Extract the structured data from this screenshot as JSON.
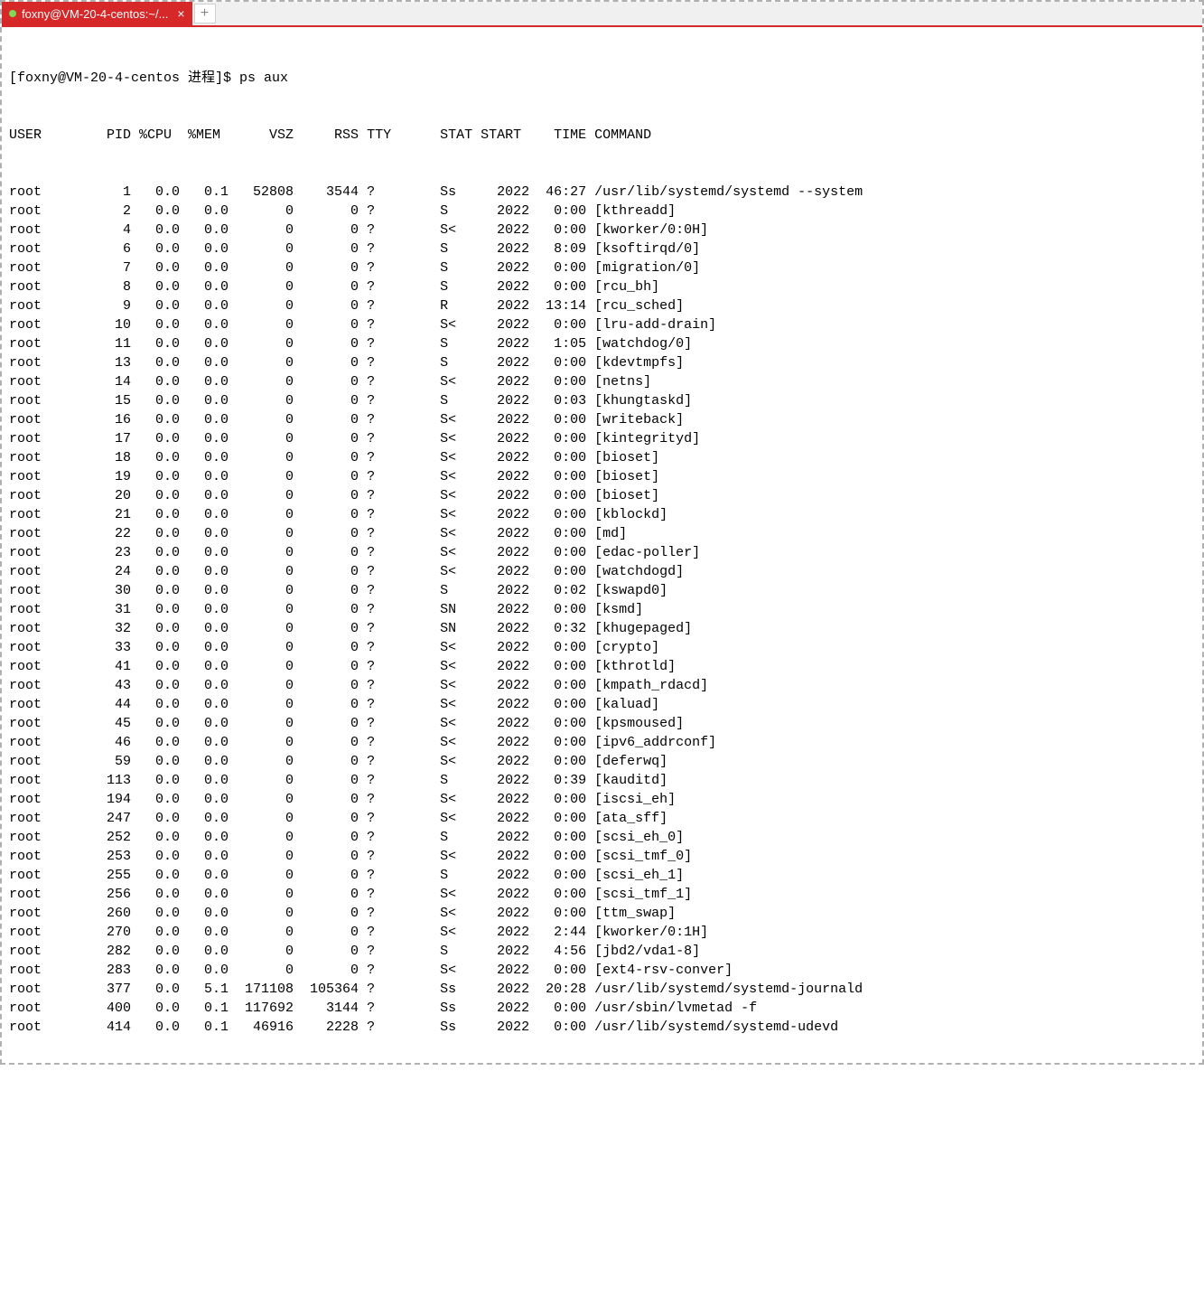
{
  "tab": {
    "title": "foxny@VM-20-4-centos:~/...",
    "close_label": "×",
    "new_tab_label": "+"
  },
  "prompt": "[foxny@VM-20-4-centos 进程]$ ps aux",
  "header": {
    "user": "USER",
    "pid": "PID",
    "cpu": "%CPU",
    "mem": "%MEM",
    "vsz": "VSZ",
    "rss": "RSS",
    "tty": "TTY",
    "stat": "STAT",
    "start": "START",
    "time": "TIME",
    "command": "COMMAND"
  },
  "rows": [
    {
      "user": "root",
      "pid": "1",
      "cpu": "0.0",
      "mem": "0.1",
      "vsz": "52808",
      "rss": "3544",
      "tty": "?",
      "stat": "Ss",
      "start": "2022",
      "time": "46:27",
      "command": "/usr/lib/systemd/systemd --system"
    },
    {
      "user": "root",
      "pid": "2",
      "cpu": "0.0",
      "mem": "0.0",
      "vsz": "0",
      "rss": "0",
      "tty": "?",
      "stat": "S",
      "start": "2022",
      "time": "0:00",
      "command": "[kthreadd]"
    },
    {
      "user": "root",
      "pid": "4",
      "cpu": "0.0",
      "mem": "0.0",
      "vsz": "0",
      "rss": "0",
      "tty": "?",
      "stat": "S<",
      "start": "2022",
      "time": "0:00",
      "command": "[kworker/0:0H]"
    },
    {
      "user": "root",
      "pid": "6",
      "cpu": "0.0",
      "mem": "0.0",
      "vsz": "0",
      "rss": "0",
      "tty": "?",
      "stat": "S",
      "start": "2022",
      "time": "8:09",
      "command": "[ksoftirqd/0]"
    },
    {
      "user": "root",
      "pid": "7",
      "cpu": "0.0",
      "mem": "0.0",
      "vsz": "0",
      "rss": "0",
      "tty": "?",
      "stat": "S",
      "start": "2022",
      "time": "0:00",
      "command": "[migration/0]"
    },
    {
      "user": "root",
      "pid": "8",
      "cpu": "0.0",
      "mem": "0.0",
      "vsz": "0",
      "rss": "0",
      "tty": "?",
      "stat": "S",
      "start": "2022",
      "time": "0:00",
      "command": "[rcu_bh]"
    },
    {
      "user": "root",
      "pid": "9",
      "cpu": "0.0",
      "mem": "0.0",
      "vsz": "0",
      "rss": "0",
      "tty": "?",
      "stat": "R",
      "start": "2022",
      "time": "13:14",
      "command": "[rcu_sched]"
    },
    {
      "user": "root",
      "pid": "10",
      "cpu": "0.0",
      "mem": "0.0",
      "vsz": "0",
      "rss": "0",
      "tty": "?",
      "stat": "S<",
      "start": "2022",
      "time": "0:00",
      "command": "[lru-add-drain]"
    },
    {
      "user": "root",
      "pid": "11",
      "cpu": "0.0",
      "mem": "0.0",
      "vsz": "0",
      "rss": "0",
      "tty": "?",
      "stat": "S",
      "start": "2022",
      "time": "1:05",
      "command": "[watchdog/0]"
    },
    {
      "user": "root",
      "pid": "13",
      "cpu": "0.0",
      "mem": "0.0",
      "vsz": "0",
      "rss": "0",
      "tty": "?",
      "stat": "S",
      "start": "2022",
      "time": "0:00",
      "command": "[kdevtmpfs]"
    },
    {
      "user": "root",
      "pid": "14",
      "cpu": "0.0",
      "mem": "0.0",
      "vsz": "0",
      "rss": "0",
      "tty": "?",
      "stat": "S<",
      "start": "2022",
      "time": "0:00",
      "command": "[netns]"
    },
    {
      "user": "root",
      "pid": "15",
      "cpu": "0.0",
      "mem": "0.0",
      "vsz": "0",
      "rss": "0",
      "tty": "?",
      "stat": "S",
      "start": "2022",
      "time": "0:03",
      "command": "[khungtaskd]"
    },
    {
      "user": "root",
      "pid": "16",
      "cpu": "0.0",
      "mem": "0.0",
      "vsz": "0",
      "rss": "0",
      "tty": "?",
      "stat": "S<",
      "start": "2022",
      "time": "0:00",
      "command": "[writeback]"
    },
    {
      "user": "root",
      "pid": "17",
      "cpu": "0.0",
      "mem": "0.0",
      "vsz": "0",
      "rss": "0",
      "tty": "?",
      "stat": "S<",
      "start": "2022",
      "time": "0:00",
      "command": "[kintegrityd]"
    },
    {
      "user": "root",
      "pid": "18",
      "cpu": "0.0",
      "mem": "0.0",
      "vsz": "0",
      "rss": "0",
      "tty": "?",
      "stat": "S<",
      "start": "2022",
      "time": "0:00",
      "command": "[bioset]"
    },
    {
      "user": "root",
      "pid": "19",
      "cpu": "0.0",
      "mem": "0.0",
      "vsz": "0",
      "rss": "0",
      "tty": "?",
      "stat": "S<",
      "start": "2022",
      "time": "0:00",
      "command": "[bioset]"
    },
    {
      "user": "root",
      "pid": "20",
      "cpu": "0.0",
      "mem": "0.0",
      "vsz": "0",
      "rss": "0",
      "tty": "?",
      "stat": "S<",
      "start": "2022",
      "time": "0:00",
      "command": "[bioset]"
    },
    {
      "user": "root",
      "pid": "21",
      "cpu": "0.0",
      "mem": "0.0",
      "vsz": "0",
      "rss": "0",
      "tty": "?",
      "stat": "S<",
      "start": "2022",
      "time": "0:00",
      "command": "[kblockd]"
    },
    {
      "user": "root",
      "pid": "22",
      "cpu": "0.0",
      "mem": "0.0",
      "vsz": "0",
      "rss": "0",
      "tty": "?",
      "stat": "S<",
      "start": "2022",
      "time": "0:00",
      "command": "[md]"
    },
    {
      "user": "root",
      "pid": "23",
      "cpu": "0.0",
      "mem": "0.0",
      "vsz": "0",
      "rss": "0",
      "tty": "?",
      "stat": "S<",
      "start": "2022",
      "time": "0:00",
      "command": "[edac-poller]"
    },
    {
      "user": "root",
      "pid": "24",
      "cpu": "0.0",
      "mem": "0.0",
      "vsz": "0",
      "rss": "0",
      "tty": "?",
      "stat": "S<",
      "start": "2022",
      "time": "0:00",
      "command": "[watchdogd]"
    },
    {
      "user": "root",
      "pid": "30",
      "cpu": "0.0",
      "mem": "0.0",
      "vsz": "0",
      "rss": "0",
      "tty": "?",
      "stat": "S",
      "start": "2022",
      "time": "0:02",
      "command": "[kswapd0]"
    },
    {
      "user": "root",
      "pid": "31",
      "cpu": "0.0",
      "mem": "0.0",
      "vsz": "0",
      "rss": "0",
      "tty": "?",
      "stat": "SN",
      "start": "2022",
      "time": "0:00",
      "command": "[ksmd]"
    },
    {
      "user": "root",
      "pid": "32",
      "cpu": "0.0",
      "mem": "0.0",
      "vsz": "0",
      "rss": "0",
      "tty": "?",
      "stat": "SN",
      "start": "2022",
      "time": "0:32",
      "command": "[khugepaged]"
    },
    {
      "user": "root",
      "pid": "33",
      "cpu": "0.0",
      "mem": "0.0",
      "vsz": "0",
      "rss": "0",
      "tty": "?",
      "stat": "S<",
      "start": "2022",
      "time": "0:00",
      "command": "[crypto]"
    },
    {
      "user": "root",
      "pid": "41",
      "cpu": "0.0",
      "mem": "0.0",
      "vsz": "0",
      "rss": "0",
      "tty": "?",
      "stat": "S<",
      "start": "2022",
      "time": "0:00",
      "command": "[kthrotld]"
    },
    {
      "user": "root",
      "pid": "43",
      "cpu": "0.0",
      "mem": "0.0",
      "vsz": "0",
      "rss": "0",
      "tty": "?",
      "stat": "S<",
      "start": "2022",
      "time": "0:00",
      "command": "[kmpath_rdacd]"
    },
    {
      "user": "root",
      "pid": "44",
      "cpu": "0.0",
      "mem": "0.0",
      "vsz": "0",
      "rss": "0",
      "tty": "?",
      "stat": "S<",
      "start": "2022",
      "time": "0:00",
      "command": "[kaluad]"
    },
    {
      "user": "root",
      "pid": "45",
      "cpu": "0.0",
      "mem": "0.0",
      "vsz": "0",
      "rss": "0",
      "tty": "?",
      "stat": "S<",
      "start": "2022",
      "time": "0:00",
      "command": "[kpsmoused]"
    },
    {
      "user": "root",
      "pid": "46",
      "cpu": "0.0",
      "mem": "0.0",
      "vsz": "0",
      "rss": "0",
      "tty": "?",
      "stat": "S<",
      "start": "2022",
      "time": "0:00",
      "command": "[ipv6_addrconf]"
    },
    {
      "user": "root",
      "pid": "59",
      "cpu": "0.0",
      "mem": "0.0",
      "vsz": "0",
      "rss": "0",
      "tty": "?",
      "stat": "S<",
      "start": "2022",
      "time": "0:00",
      "command": "[deferwq]"
    },
    {
      "user": "root",
      "pid": "113",
      "cpu": "0.0",
      "mem": "0.0",
      "vsz": "0",
      "rss": "0",
      "tty": "?",
      "stat": "S",
      "start": "2022",
      "time": "0:39",
      "command": "[kauditd]"
    },
    {
      "user": "root",
      "pid": "194",
      "cpu": "0.0",
      "mem": "0.0",
      "vsz": "0",
      "rss": "0",
      "tty": "?",
      "stat": "S<",
      "start": "2022",
      "time": "0:00",
      "command": "[iscsi_eh]"
    },
    {
      "user": "root",
      "pid": "247",
      "cpu": "0.0",
      "mem": "0.0",
      "vsz": "0",
      "rss": "0",
      "tty": "?",
      "stat": "S<",
      "start": "2022",
      "time": "0:00",
      "command": "[ata_sff]"
    },
    {
      "user": "root",
      "pid": "252",
      "cpu": "0.0",
      "mem": "0.0",
      "vsz": "0",
      "rss": "0",
      "tty": "?",
      "stat": "S",
      "start": "2022",
      "time": "0:00",
      "command": "[scsi_eh_0]"
    },
    {
      "user": "root",
      "pid": "253",
      "cpu": "0.0",
      "mem": "0.0",
      "vsz": "0",
      "rss": "0",
      "tty": "?",
      "stat": "S<",
      "start": "2022",
      "time": "0:00",
      "command": "[scsi_tmf_0]"
    },
    {
      "user": "root",
      "pid": "255",
      "cpu": "0.0",
      "mem": "0.0",
      "vsz": "0",
      "rss": "0",
      "tty": "?",
      "stat": "S",
      "start": "2022",
      "time": "0:00",
      "command": "[scsi_eh_1]"
    },
    {
      "user": "root",
      "pid": "256",
      "cpu": "0.0",
      "mem": "0.0",
      "vsz": "0",
      "rss": "0",
      "tty": "?",
      "stat": "S<",
      "start": "2022",
      "time": "0:00",
      "command": "[scsi_tmf_1]"
    },
    {
      "user": "root",
      "pid": "260",
      "cpu": "0.0",
      "mem": "0.0",
      "vsz": "0",
      "rss": "0",
      "tty": "?",
      "stat": "S<",
      "start": "2022",
      "time": "0:00",
      "command": "[ttm_swap]"
    },
    {
      "user": "root",
      "pid": "270",
      "cpu": "0.0",
      "mem": "0.0",
      "vsz": "0",
      "rss": "0",
      "tty": "?",
      "stat": "S<",
      "start": "2022",
      "time": "2:44",
      "command": "[kworker/0:1H]"
    },
    {
      "user": "root",
      "pid": "282",
      "cpu": "0.0",
      "mem": "0.0",
      "vsz": "0",
      "rss": "0",
      "tty": "?",
      "stat": "S",
      "start": "2022",
      "time": "4:56",
      "command": "[jbd2/vda1-8]"
    },
    {
      "user": "root",
      "pid": "283",
      "cpu": "0.0",
      "mem": "0.0",
      "vsz": "0",
      "rss": "0",
      "tty": "?",
      "stat": "S<",
      "start": "2022",
      "time": "0:00",
      "command": "[ext4-rsv-conver]"
    },
    {
      "user": "root",
      "pid": "377",
      "cpu": "0.0",
      "mem": "5.1",
      "vsz": "171108",
      "rss": "105364",
      "tty": "?",
      "stat": "Ss",
      "start": "2022",
      "time": "20:28",
      "command": "/usr/lib/systemd/systemd-journald"
    },
    {
      "user": "root",
      "pid": "400",
      "cpu": "0.0",
      "mem": "0.1",
      "vsz": "117692",
      "rss": "3144",
      "tty": "?",
      "stat": "Ss",
      "start": "2022",
      "time": "0:00",
      "command": "/usr/sbin/lvmetad -f"
    },
    {
      "user": "root",
      "pid": "414",
      "cpu": "0.0",
      "mem": "0.1",
      "vsz": "46916",
      "rss": "2228",
      "tty": "?",
      "stat": "Ss",
      "start": "2022",
      "time": "0:00",
      "command": "/usr/lib/systemd/systemd-udevd"
    }
  ]
}
